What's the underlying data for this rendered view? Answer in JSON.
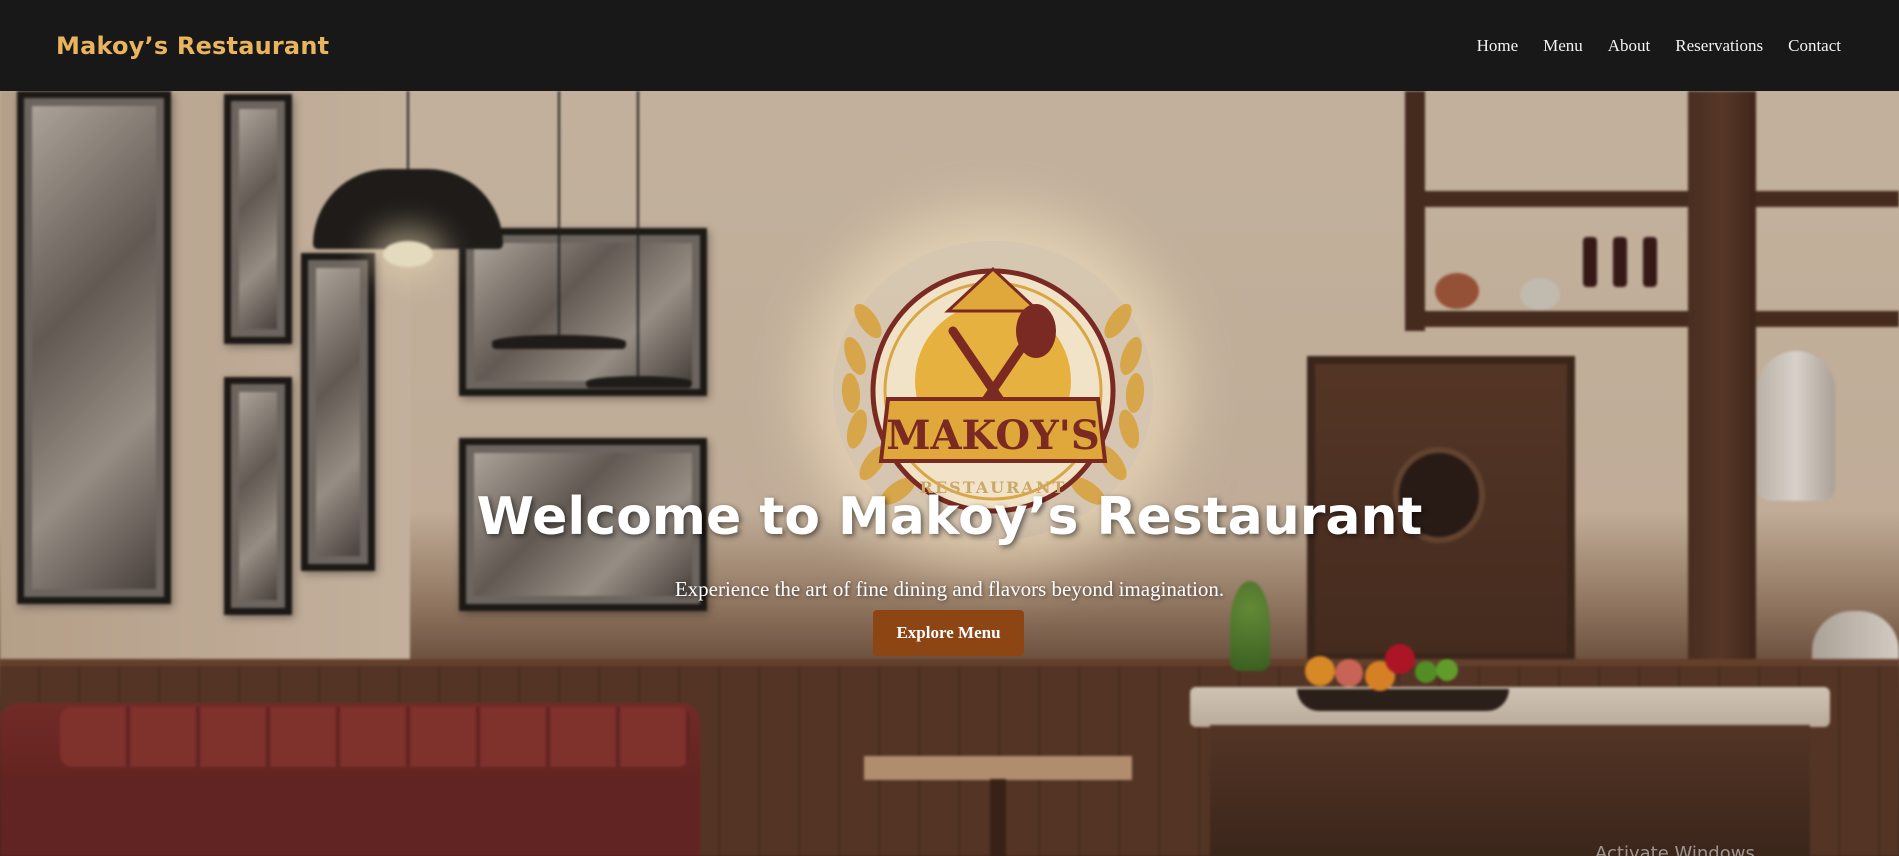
{
  "navbar": {
    "brand": "Makoy’s Restaurant",
    "links": [
      "Home",
      "Menu",
      "About",
      "Reservations",
      "Contact"
    ]
  },
  "hero": {
    "title": "Welcome to Makoy’s Restaurant",
    "subtitle": "Experience the art of fine dining and flavors beyond imagination.",
    "button_label": "Explore Menu",
    "logo": {
      "name": "MAKOY'S",
      "tagline": "RESTAURANT"
    }
  },
  "os_watermark": "Activate Windows",
  "colors": {
    "navbar_bg": "#181818",
    "brand": "#e8b45e",
    "button": "#8c4513",
    "logo_gold": "#e0a83a",
    "logo_maroon": "#7a2a22"
  }
}
